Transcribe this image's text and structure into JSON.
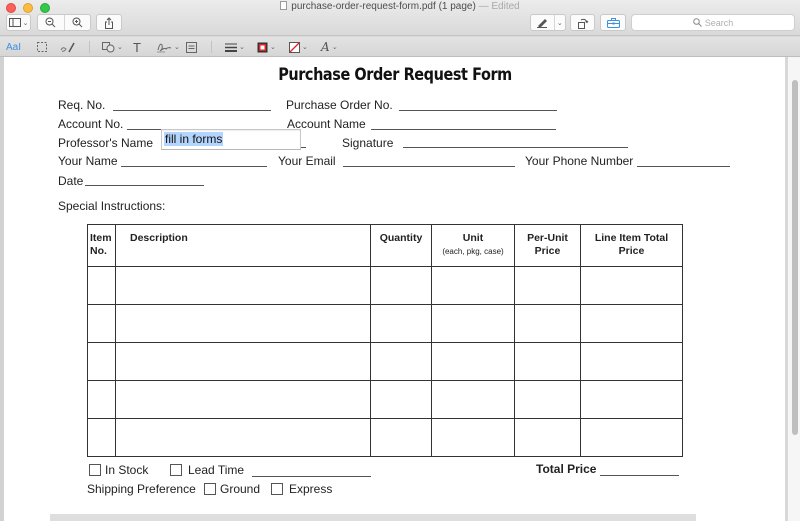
{
  "window": {
    "filename": "purchase-order-request-form.pdf",
    "page_count": "(1 page)",
    "separator": "—",
    "status": "Edited"
  },
  "toolbar": {
    "sidebar_icon": "sidebar-icon",
    "zoom_out_icon": "zoom-out-icon",
    "zoom_in_icon": "zoom-in-icon",
    "share_icon": "share-icon",
    "markup_pen_icon": "markup-pen-icon",
    "rotate_icon": "rotate-icon",
    "toolbox_icon": "toolbox-icon",
    "search_placeholder": "Search"
  },
  "markup_bar": {
    "text_selection": "AaI",
    "tools": [
      "selection",
      "sketch",
      "shapes",
      "text",
      "sign",
      "note",
      "line-style",
      "border-color",
      "fill-color",
      "text-style"
    ]
  },
  "form": {
    "title": "Purchase Order Request Form",
    "fields": {
      "req_no": "Req. No.",
      "po_no": "Purchase Order No.",
      "account_no": "Account No.",
      "account_name": "Account Name",
      "professor_name": "Professor's Name",
      "signature": "Signature",
      "your_name": "Your Name",
      "your_email": "Your Email",
      "your_phone": "Your Phone Number",
      "date": "Date",
      "special_instructions": "Special Instructions:"
    },
    "active_field_value": "fill in forms",
    "table": {
      "headers": [
        {
          "line1": "Item",
          "line2": "No."
        },
        {
          "line1": "Description",
          "line2": ""
        },
        {
          "line1": "Quantity",
          "line2": ""
        },
        {
          "line1": "Unit",
          "line2": "(each, pkg, case)"
        },
        {
          "line1": "Per-Unit",
          "line2": "Price"
        },
        {
          "line1": "Line Item Total",
          "line2": "Price"
        }
      ],
      "rows": [
        [
          "",
          "",
          "",
          "",
          "",
          ""
        ],
        [
          "",
          "",
          "",
          "",
          "",
          ""
        ],
        [
          "",
          "",
          "",
          "",
          "",
          ""
        ],
        [
          "",
          "",
          "",
          "",
          "",
          ""
        ],
        [
          "",
          "",
          "",
          "",
          "",
          ""
        ]
      ]
    },
    "in_stock": "In Stock",
    "lead_time": "Lead Time",
    "total_price": "Total Price",
    "shipping_preference": "Shipping Preference",
    "ground": "Ground",
    "express": "Express"
  }
}
